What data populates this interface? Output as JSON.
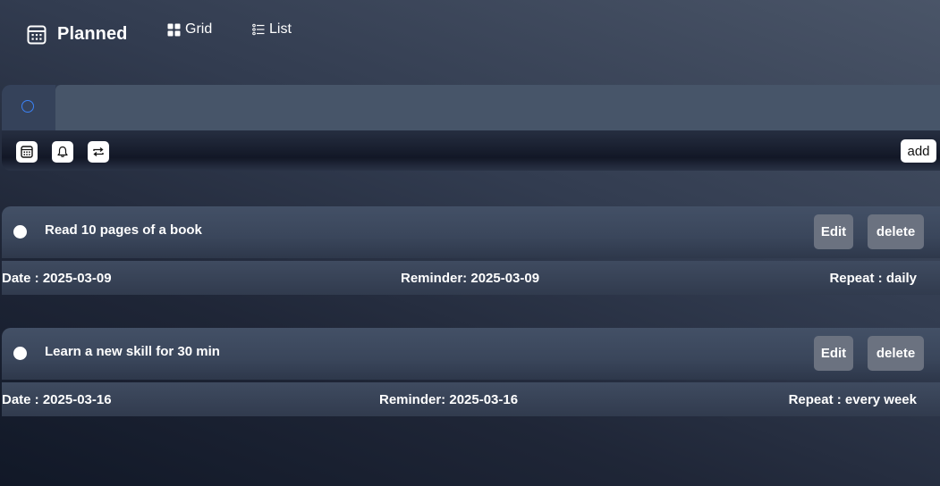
{
  "header": {
    "title": "Planned",
    "views": [
      {
        "label": "Grid",
        "icon": "grid-icon"
      },
      {
        "label": "List",
        "icon": "list-icon"
      }
    ]
  },
  "composer": {
    "input_value": "",
    "input_placeholder": "",
    "tools": [
      "calendar-icon",
      "bell-icon",
      "repeat-icon"
    ],
    "add_label": "add",
    "accent_color": "#3b82f6"
  },
  "tasks": [
    {
      "text": "Read 10 pages of a book",
      "edit_label": "Edit",
      "delete_label": "delete",
      "date": "Date : 2025-03-09",
      "reminder": "Reminder: 2025-03-09",
      "repeat": "Repeat : daily"
    },
    {
      "text": "Learn a new skill for 30 min",
      "edit_label": "Edit",
      "delete_label": "delete",
      "date": "Date : 2025-03-16",
      "reminder": "Reminder: 2025-03-16",
      "repeat": "Repeat : every week"
    }
  ],
  "colors": {
    "button_gray": "#6b7280",
    "input_bg": "#475569"
  }
}
